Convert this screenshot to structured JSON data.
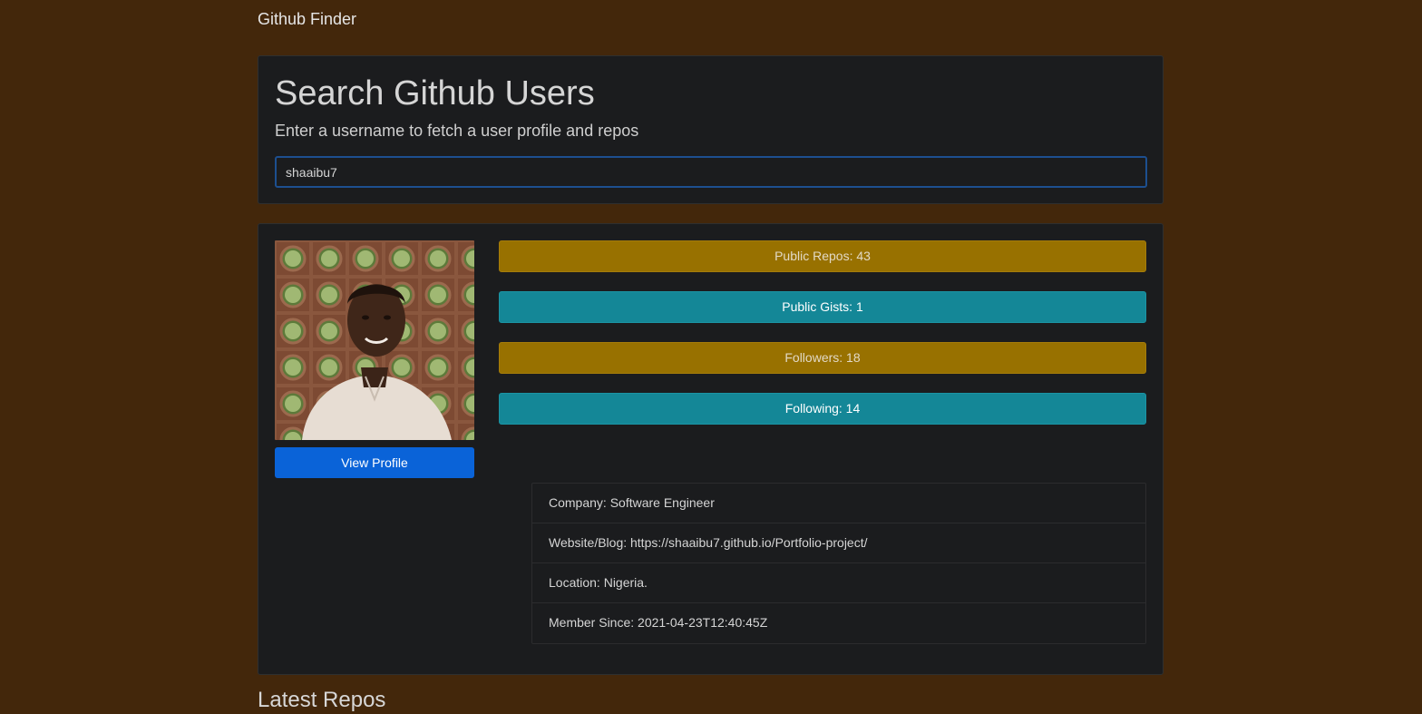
{
  "navbar": {
    "brand": "Github Finder"
  },
  "search": {
    "title": "Search Github Users",
    "subtitle": "Enter a username to fetch a user profile and repos",
    "input_value": "shaaibu7"
  },
  "profile": {
    "view_profile_label": "View Profile",
    "stats": {
      "public_repos": "Public Repos: 43",
      "public_gists": "Public Gists: 1",
      "followers": "Followers: 18",
      "following": "Following: 14"
    },
    "details": {
      "company": "Company: Software Engineer",
      "website": "Website/Blog: https://shaaibu7.github.io/Portfolio-project/",
      "location": "Location: Nigeria.",
      "member_since": "Member Since: 2021-04-23T12:40:45Z"
    }
  },
  "repos": {
    "heading": "Latest Repos"
  },
  "colors": {
    "page_background": "#43270b",
    "card_background": "#1b1c1e",
    "primary_button": "#0a63d8",
    "warning_badge": "#987100",
    "info_badge": "#148797"
  }
}
